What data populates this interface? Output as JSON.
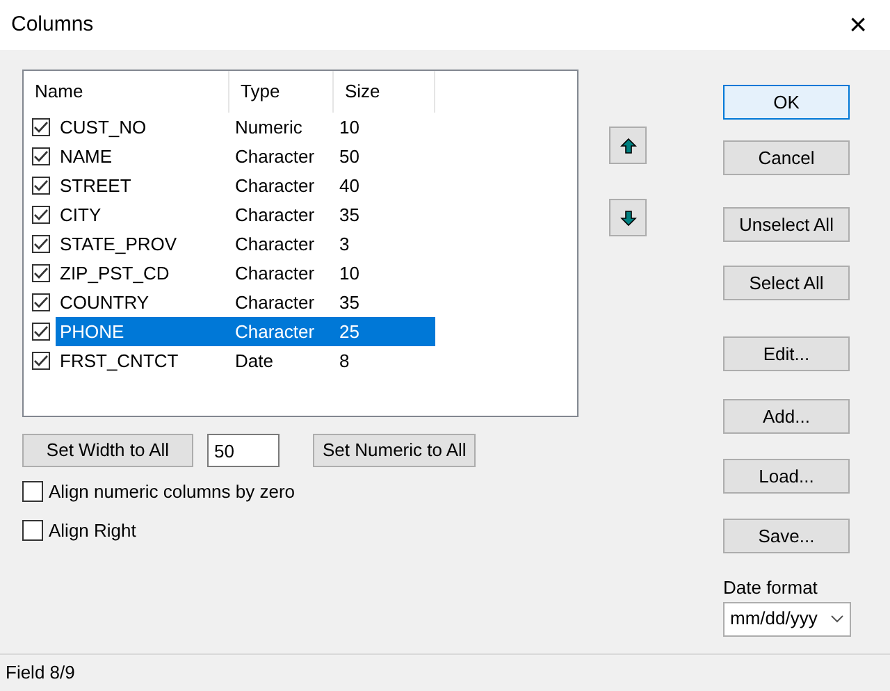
{
  "window": {
    "title": "Columns",
    "close": "×"
  },
  "list": {
    "columns": [
      "Name",
      "Type",
      "Size"
    ],
    "rows": [
      {
        "name": "CUST_NO",
        "type": "Numeric",
        "size": "10",
        "checked": true,
        "selected": false
      },
      {
        "name": "NAME",
        "type": "Character",
        "size": "50",
        "checked": true,
        "selected": false
      },
      {
        "name": "STREET",
        "type": "Character",
        "size": "40",
        "checked": true,
        "selected": false
      },
      {
        "name": "CITY",
        "type": "Character",
        "size": "35",
        "checked": true,
        "selected": false
      },
      {
        "name": "STATE_PROV",
        "type": "Character",
        "size": "3",
        "checked": true,
        "selected": false
      },
      {
        "name": "ZIP_PST_CD",
        "type": "Character",
        "size": "10",
        "checked": true,
        "selected": false
      },
      {
        "name": "COUNTRY",
        "type": "Character",
        "size": "35",
        "checked": true,
        "selected": false
      },
      {
        "name": "PHONE",
        "type": "Character",
        "size": "25",
        "checked": true,
        "selected": true
      },
      {
        "name": "FRST_CNTCT",
        "type": "Date",
        "size": "8",
        "checked": true,
        "selected": false
      }
    ]
  },
  "width_controls": {
    "set_width_button": "Set Width to All",
    "width_value": "50",
    "set_numeric_button": "Set Numeric to All"
  },
  "options": [
    {
      "label": "Align numeric columns by zero",
      "checked": false
    },
    {
      "label": "Align Right",
      "checked": false
    }
  ],
  "buttons": [
    {
      "label": "OK",
      "focused": true
    },
    {
      "label": "Cancel",
      "focused": false
    },
    {
      "label": "Unselect All",
      "focused": false
    },
    {
      "label": "Select All",
      "focused": false
    },
    {
      "label": "Edit...",
      "focused": false
    },
    {
      "label": "Add...",
      "focused": false
    },
    {
      "label": "Load...",
      "focused": false
    },
    {
      "label": "Save...",
      "focused": false
    }
  ],
  "date_format": {
    "label": "Date format",
    "value": "mm/dd/yyy"
  },
  "status_bar": "Field 8/9"
}
